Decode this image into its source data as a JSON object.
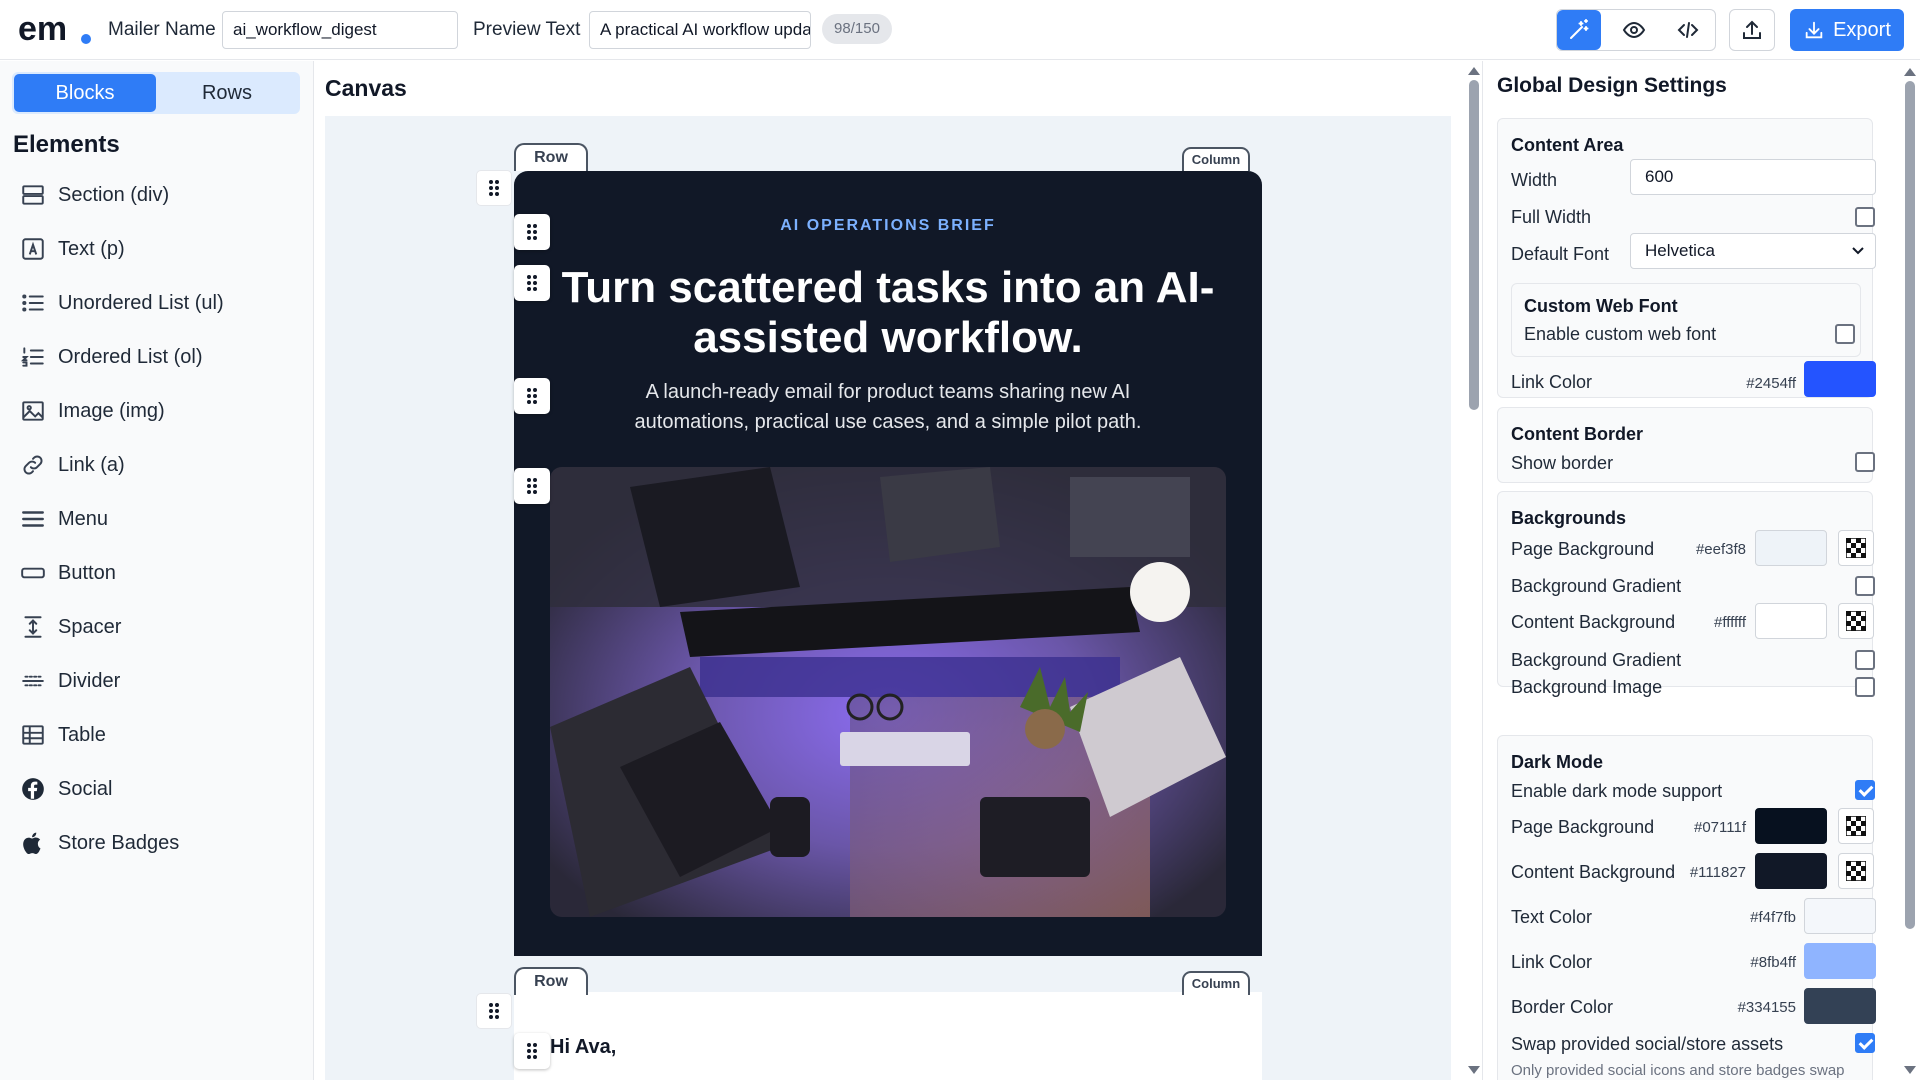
{
  "topbar": {
    "mailer_name_label": "Mailer Name",
    "mailer_name_value": "ai_workflow_digest",
    "preview_text_label": "Preview Text",
    "preview_text_value": "A practical AI workflow upda",
    "char_count": "98/150",
    "export_label": "Export",
    "icons": [
      "magic-wand-icon",
      "eye-icon",
      "code-icon",
      "upload-icon",
      "download-icon"
    ]
  },
  "sidebar": {
    "tabs": [
      {
        "label": "Blocks",
        "active": true
      },
      {
        "label": "Rows",
        "active": false
      }
    ],
    "heading": "Elements",
    "elements": [
      {
        "label": "Section (div)",
        "icon": "section-icon"
      },
      {
        "label": "Text (p)",
        "icon": "text-icon"
      },
      {
        "label": "Unordered List (ul)",
        "icon": "unordered-list-icon"
      },
      {
        "label": "Ordered List (ol)",
        "icon": "ordered-list-icon"
      },
      {
        "label": "Image (img)",
        "icon": "image-icon"
      },
      {
        "label": "Link (a)",
        "icon": "link-icon"
      },
      {
        "label": "Menu",
        "icon": "menu-icon"
      },
      {
        "label": "Button",
        "icon": "button-icon"
      },
      {
        "label": "Spacer",
        "icon": "spacer-icon"
      },
      {
        "label": "Divider",
        "icon": "divider-icon"
      },
      {
        "label": "Table",
        "icon": "table-icon"
      },
      {
        "label": "Social",
        "icon": "facebook-icon"
      },
      {
        "label": "Store Badges",
        "icon": "apple-icon"
      }
    ]
  },
  "canvas": {
    "title": "Canvas",
    "row_label": "Row",
    "column_label": "Column",
    "hero": {
      "eyebrow": "AI OPERATIONS BRIEF",
      "title": "Turn scattered tasks into an AI-assisted workflow.",
      "subtitle": "A launch-ready email for product teams sharing new AI automations, practical use cases, and a simple pilot path.",
      "image_alt": "desk-photo"
    },
    "greeting": "Hi Ava,"
  },
  "settings": {
    "title": "Global Design Settings",
    "content_area": {
      "title": "Content Area",
      "width_label": "Width",
      "width_value": "600",
      "full_width_label": "Full Width",
      "full_width_checked": false,
      "default_font_label": "Default Font",
      "default_font_value": "Helvetica",
      "custom_font_title": "Custom Web Font",
      "custom_font_label": "Enable custom web font",
      "custom_font_checked": false,
      "link_color_label": "Link Color",
      "link_color_hex": "#2454ff"
    },
    "content_border": {
      "title": "Content Border",
      "show_border_label": "Show border",
      "show_border_checked": false
    },
    "backgrounds": {
      "title": "Backgrounds",
      "page_bg_label": "Page Background",
      "page_bg_hex": "#eef3f8",
      "bg_gradient_label": "Background Gradient",
      "content_bg_label": "Content Background",
      "content_bg_hex": "#ffffff",
      "bg_gradient2_label": "Background Gradient",
      "bg_image_label": "Background Image"
    },
    "dark_mode": {
      "title": "Dark Mode",
      "enable_label": "Enable dark mode support",
      "enable_checked": true,
      "page_bg_label": "Page Background",
      "page_bg_hex": "#07111f",
      "content_bg_label": "Content Background",
      "content_bg_hex": "#111827",
      "text_color_label": "Text Color",
      "text_color_hex": "#f4f7fb",
      "link_color_label": "Link Color",
      "link_color_hex": "#8fb4ff",
      "border_color_label": "Border Color",
      "border_color_hex": "#334155",
      "swap_label": "Swap provided social/store assets",
      "swap_checked": true,
      "note": "Only provided social icons and store badges swap"
    }
  },
  "colors": {
    "accent": "#2f7cf6",
    "hero_bg": "#111827",
    "eyebrow": "#7cb1ff"
  }
}
